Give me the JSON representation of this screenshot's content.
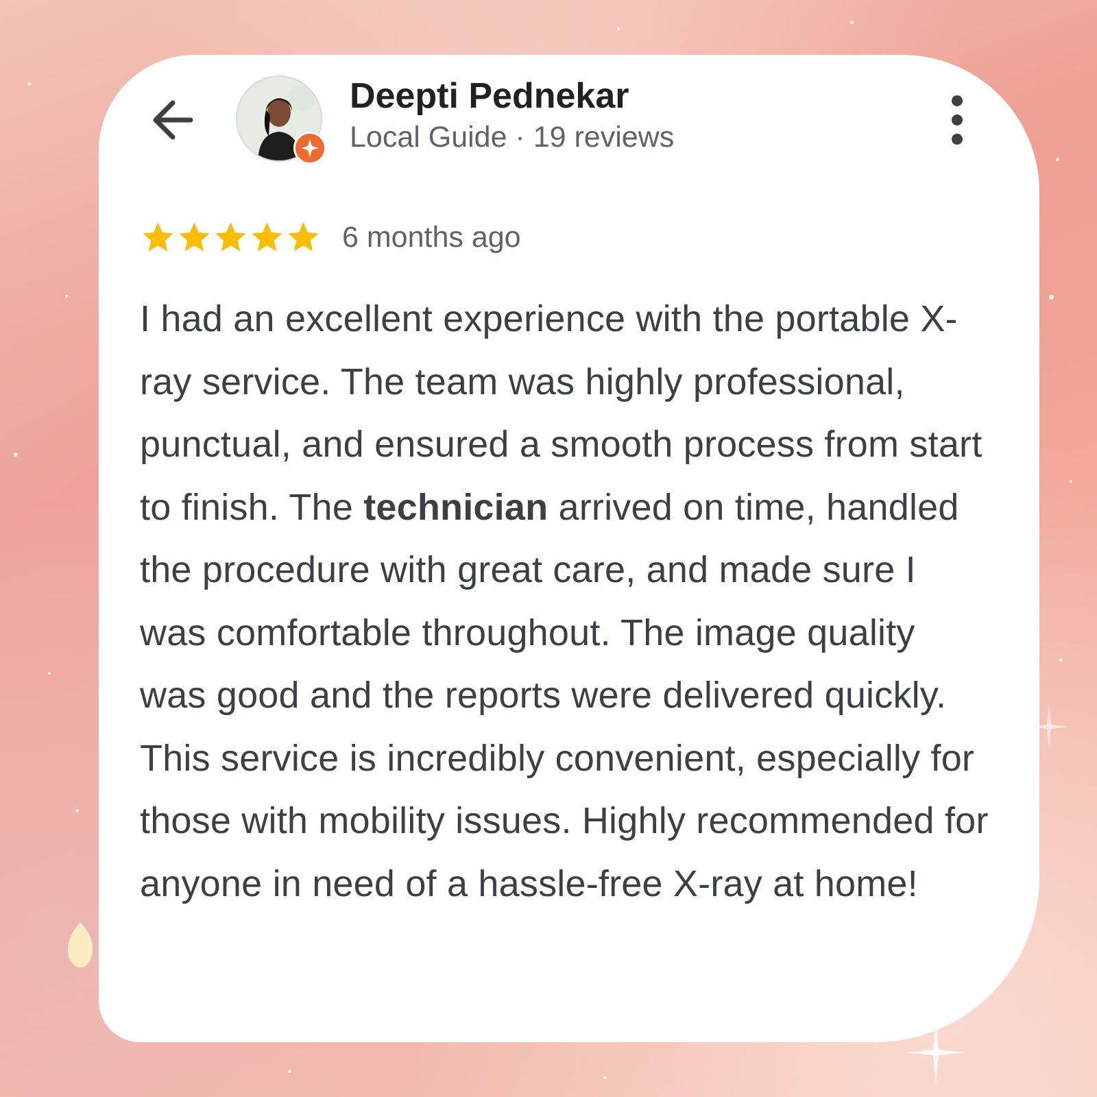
{
  "reviewer": {
    "name": "Deepti Pednekar",
    "meta": "Local Guide · 19 reviews",
    "avatar_icon": "avatar-photo",
    "badge_icon": "local-guide-star-icon",
    "badge_color": "#ee6a2f"
  },
  "navigation": {
    "back_icon": "arrow-left-icon",
    "menu_icon": "more-vertical-icon"
  },
  "review": {
    "rating": 5,
    "rating_max": 5,
    "star_color": "#fbbc04",
    "time_ago": "6 months ago",
    "text_before": "I had an excellent experience with the portable X-ray service. The team was highly professional, punctual, and ensured a smooth process from start to finish. The ",
    "text_bold": "technician",
    "text_after": " arrived on time, handled the procedure with great care, and made sure I was comfortable throughout. The image quality was good and the reports were delivered quickly. This service is incredibly convenient, especially for those with mobility issues. Highly recommended for anyone in need of a hassle-free X-ray at home!"
  },
  "colors": {
    "background_pink": "#ee9f93",
    "card": "#ffffff",
    "text_primary": "#202124",
    "text_secondary": "#5f6368"
  }
}
